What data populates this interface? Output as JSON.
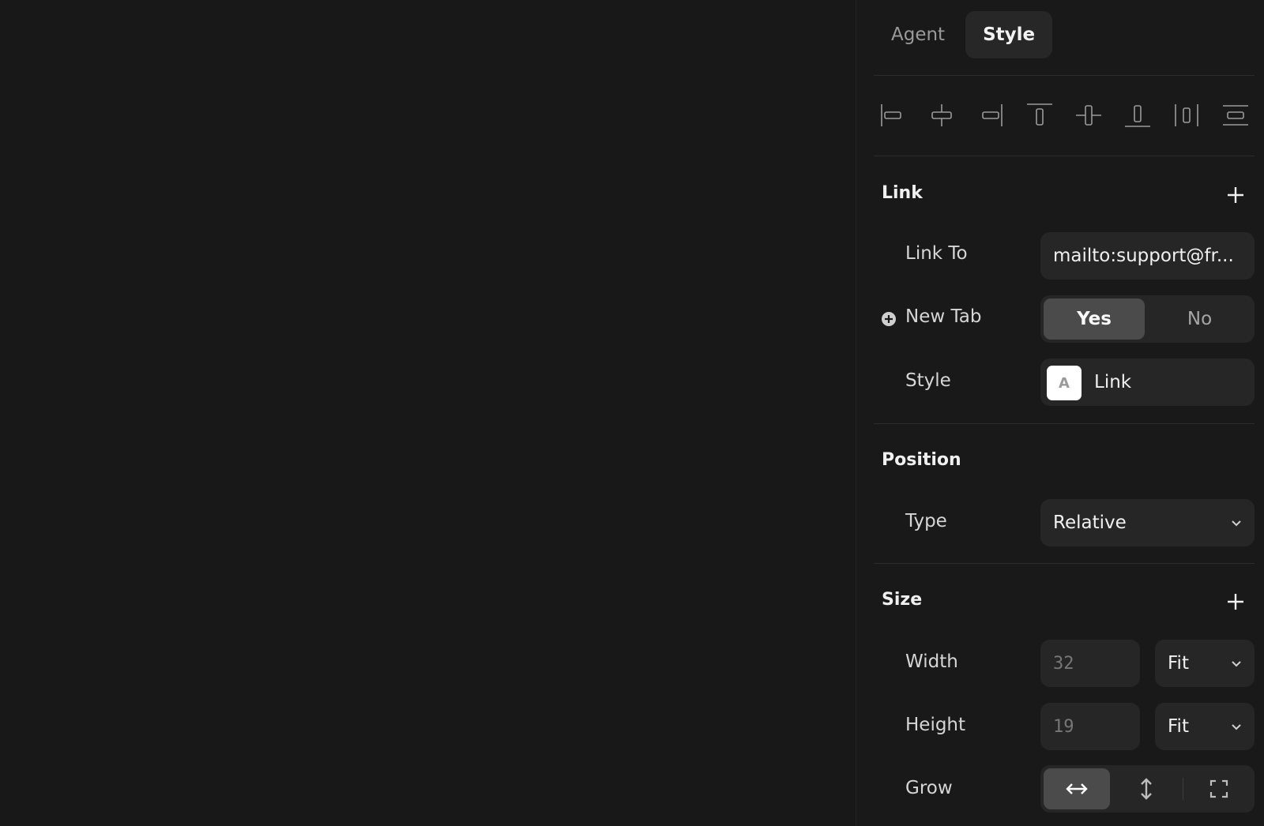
{
  "tabs": [
    {
      "label": "Agent",
      "active": false
    },
    {
      "label": "Style",
      "active": true
    }
  ],
  "alignment_icons": [
    "align-left-icon",
    "align-horizontal-center-icon",
    "align-right-icon",
    "align-top-icon",
    "align-vertical-center-icon",
    "align-bottom-icon",
    "distribute-horizontal-icon",
    "distribute-vertical-icon"
  ],
  "link": {
    "title": "Link",
    "link_to_label": "Link To",
    "link_to_value": "mailto:support@fr...",
    "new_tab_label": "New Tab",
    "new_tab_options": [
      "Yes",
      "No"
    ],
    "new_tab_selected": "Yes",
    "style_label": "Style",
    "style_swatch_letter": "A",
    "style_value": "Link"
  },
  "position": {
    "title": "Position",
    "type_label": "Type",
    "type_value": "Relative"
  },
  "size": {
    "title": "Size",
    "width_label": "Width",
    "width_value": "32",
    "width_mode": "Fit",
    "height_label": "Height",
    "height_value": "19",
    "height_mode": "Fit",
    "grow_label": "Grow",
    "grow_options": [
      "grow-horizontal-icon",
      "grow-vertical-icon",
      "grow-fill-icon"
    ],
    "grow_selected": "grow-horizontal-icon"
  },
  "colors": {
    "canvas_bg": "#181818",
    "panel_bg": "#191919",
    "field_bg": "#262626",
    "active_segment": "#4b4b4b"
  }
}
